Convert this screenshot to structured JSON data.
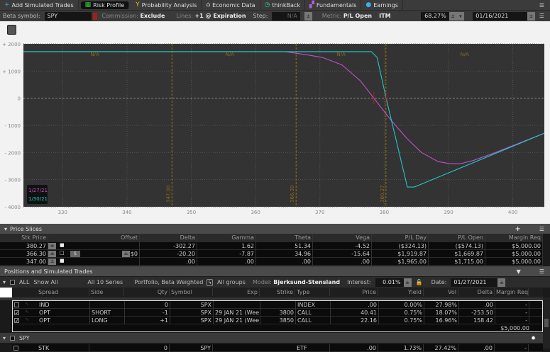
{
  "tabs": [
    {
      "label": "Add Simulated Trades",
      "icon": "plus-icon",
      "active": false
    },
    {
      "label": "Risk Profile",
      "icon": "risk-profile-icon",
      "active": true
    },
    {
      "label": "Probability Analysis",
      "icon": "probability-icon",
      "active": false
    },
    {
      "label": "Economic Data",
      "icon": "bank-icon",
      "active": false
    },
    {
      "label": "thinkBack",
      "icon": "clock-icon",
      "active": false
    },
    {
      "label": "Fundamentals",
      "icon": "blocks-icon",
      "active": false
    },
    {
      "label": "Earnings",
      "icon": "lightbulb-icon",
      "active": false
    }
  ],
  "settings": {
    "beta_label": "Beta symbol:",
    "beta_value": "SPY",
    "commission_label": "Commission:",
    "commission_value": "Exclude",
    "lines_label": "Lines:",
    "lines_value": "+1 @ Expiration",
    "step_label": "Step:",
    "step_value": "N/A",
    "metric_label": "Metric:",
    "metric_value": "P/L Open",
    "itm": "ITM",
    "prob": "68.27%",
    "date": "01/16/2021"
  },
  "chart_data": {
    "type": "line",
    "xlim": [
      323.9,
      404.9
    ],
    "ylim": [
      -4000,
      2000
    ],
    "xticks": [
      330,
      340,
      350,
      360,
      370,
      380,
      390,
      400
    ],
    "yticks": [
      {
        "v": 2000,
        "l": "+ 2000"
      },
      {
        "v": 1000,
        "l": "+ 1000"
      },
      {
        "v": 0,
        "l": "0"
      },
      {
        "v": -1000,
        "l": "- 1000"
      },
      {
        "v": -2000,
        "l": "- 2000"
      },
      {
        "v": -3000,
        "l": "- 3000"
      },
      {
        "v": -4000,
        "l": "- 4000"
      }
    ],
    "grid": true,
    "series": [
      {
        "name": "1/27/21",
        "color": "#c050c8",
        "points": [
          [
            323.9,
            1715
          ],
          [
            364.6,
            1715
          ],
          [
            368.2,
            1590
          ],
          [
            370.4,
            1500
          ],
          [
            373.4,
            1230
          ],
          [
            376.3,
            640
          ],
          [
            378.4,
            0
          ],
          [
            381.1,
            -820
          ],
          [
            383.6,
            -1500
          ],
          [
            385.8,
            -2000
          ],
          [
            388.4,
            -2335
          ],
          [
            390.2,
            -2410
          ],
          [
            391.9,
            -2410
          ],
          [
            393.9,
            -2290
          ],
          [
            396.8,
            -2045
          ],
          [
            404.9,
            -1290
          ]
        ]
      },
      {
        "name": "1/30/21",
        "color": "#20c8c8",
        "points": [
          [
            323.9,
            1715
          ],
          [
            378.0,
            1715
          ],
          [
            378.9,
            1500
          ],
          [
            380.3,
            0
          ],
          [
            383.6,
            -3270
          ],
          [
            384.7,
            -3270
          ],
          [
            404.9,
            -1290
          ]
        ]
      }
    ],
    "vlines": [
      {
        "x": 347.0,
        "label": "347.00"
      },
      {
        "x": 366.3,
        "label": "366.30"
      },
      {
        "x": 380.27,
        "label": "380.27"
      }
    ],
    "region_labels": [
      {
        "x": 335,
        "text": "N/A"
      },
      {
        "x": 356,
        "text": "N/A"
      },
      {
        "x": 373.3,
        "text": "N/A"
      },
      {
        "x": 392.5,
        "text": "N/A"
      }
    ],
    "markers": [
      378.4,
      380.3
    ],
    "legend_placement": "bottom-left"
  },
  "price_slices": {
    "title": "Price Slices",
    "columns": [
      "Stk Price",
      "Offset",
      "Delta",
      "Gamma",
      "Theta",
      "Vega",
      "P/L Day",
      "P/L Open",
      "Margin Req"
    ],
    "rows": [
      {
        "stk": "380.27",
        "offset": "",
        "delta": "-302.27",
        "gamma": "1.62",
        "theta": "51.34",
        "vega": "-4.52",
        "pl_day": "($324.13)",
        "pl_open": "($574.13)",
        "margin": "$5,000.00",
        "locked": true
      },
      {
        "stk": "366.30",
        "offset": "$0",
        "delta": "-20.20",
        "gamma": "-7.87",
        "theta": "34.96",
        "vega": "-15.64",
        "pl_day": "$1,919.87",
        "pl_open": "$1,669.87",
        "margin": "$5,000.00",
        "locked": false
      },
      {
        "stk": "347.00",
        "offset": "",
        "delta": ".00",
        "gamma": ".00",
        "theta": ".00",
        "vega": ".00",
        "pl_day": "$1,965.00",
        "pl_open": "$1,715.00",
        "margin": "$5,000.00",
        "locked": true
      }
    ]
  },
  "positions": {
    "title": "Positions and Simulated Trades",
    "toolbar": {
      "all": "ALL",
      "show": "Show All",
      "series": "All 10 Series",
      "portfolio": "Portfolio, Beta Weighted",
      "groups": "All groups",
      "model_label": "Model:",
      "model": "Bjerksund-Stensland",
      "interest_label": "Interest:",
      "interest": "0.01%",
      "date_label": "Date:",
      "date": "01/27/2021"
    },
    "columns": [
      "Spread",
      "Side",
      "Qty",
      "Symbol",
      "Exp",
      "Strike",
      "Type",
      "Price",
      "Yield",
      "Vol",
      "Delta",
      "Margin Req"
    ],
    "rows": [
      {
        "checked": false,
        "spread": "IND",
        "side": "",
        "qty": "0",
        "symbol": "SPX",
        "exp": "",
        "strike": "",
        "type": "INDEX",
        "price": ".00",
        "yield": "0.00%",
        "vol": "27.98%",
        "delta": ".00",
        "margin": "-"
      },
      {
        "checked": true,
        "spread": "OPT",
        "side": "SHORT",
        "qty": "-1",
        "symbol": "SPX",
        "exp": "29 JAN 21 (Wee...",
        "strike": "3800",
        "type": "CALL",
        "price": "40.41",
        "yield": "0.75%",
        "vol": "18.07%",
        "delta": "-253.50",
        "margin": "-"
      },
      {
        "checked": true,
        "spread": "OPT",
        "side": "LONG",
        "qty": "+1",
        "symbol": "SPX",
        "exp": "29 JAN 21 (Wee...",
        "strike": "3850",
        "type": "CALL",
        "price": "22.16",
        "yield": "0.75%",
        "vol": "16.96%",
        "delta": "158.42",
        "margin": "-"
      }
    ],
    "group_margin": "$5,000.00",
    "group2": {
      "name": "SPY",
      "row": {
        "spread": "STK",
        "qty": "0",
        "symbol": "SPY",
        "type": "ETF",
        "price": ".00",
        "yield": "1.73%",
        "vol": "27.42%",
        "delta": ".00",
        "margin": "-"
      }
    }
  }
}
